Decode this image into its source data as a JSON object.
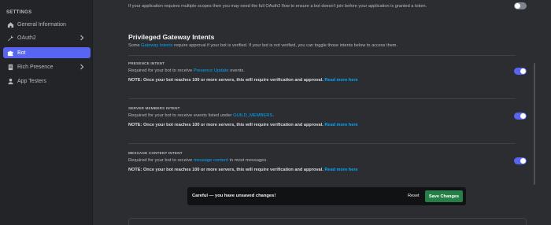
{
  "sidebar": {
    "heading": "SETTINGS",
    "items": [
      {
        "label": "General Information",
        "icon": "home-icon",
        "chevron": false
      },
      {
        "label": "OAuth2",
        "icon": "wrench-icon",
        "chevron": true
      },
      {
        "label": "Bot",
        "icon": "puzzle-icon",
        "chevron": false,
        "active": true
      },
      {
        "label": "Rich Presence",
        "icon": "document-icon",
        "chevron": true
      },
      {
        "label": "App Testers",
        "icon": "person-icon",
        "chevron": false
      }
    ]
  },
  "main": {
    "top_text": "If your application requires multiple scopes then you may need the full OAuth2 flow to ensure a bot doesn't join before your application is granted a token.",
    "section_title": "Privileged Gateway Intents",
    "section_sub_pre": "Some ",
    "section_sub_link": "Gateway Intents",
    "section_sub_post": " require approval if your bot is verified. If your bot is not verified, you can toggle those intents below to access them.",
    "intents": [
      {
        "title": "PRESENCE INTENT",
        "desc_pre": "Required for your bot to receive ",
        "desc_link": "Presence Update",
        "desc_post": " events.",
        "note_pre": "NOTE: Once your bot reaches 100 or more servers, this will require verification and approval. ",
        "note_link": "Read more here",
        "enabled": true
      },
      {
        "title": "SERVER MEMBERS INTENT",
        "desc_pre": "Required for your bot to receive events listed under ",
        "desc_link": "GUILD_MEMBERS",
        "desc_post": ".",
        "note_pre": "NOTE: Once your bot reaches 100 or more servers, this will require verification and approval. ",
        "note_link": "Read more here",
        "enabled": true
      },
      {
        "title": "MESSAGE CONTENT INTENT",
        "desc_pre": "Required for your bot to receive ",
        "desc_link": "message content",
        "desc_post": " in most messages.",
        "note_pre": "NOTE: Once your bot reaches 100 or more servers, this will require verification and approval. ",
        "note_link": "Read more here",
        "enabled": true
      }
    ],
    "top_toggle_enabled": false
  },
  "unsaved_bar": {
    "message": "Careful — you have unsaved changes!",
    "reset_label": "Reset",
    "save_label": "Save Changes"
  },
  "colors": {
    "accent": "#5865f2",
    "link": "#00a8fc",
    "save": "#248046"
  }
}
